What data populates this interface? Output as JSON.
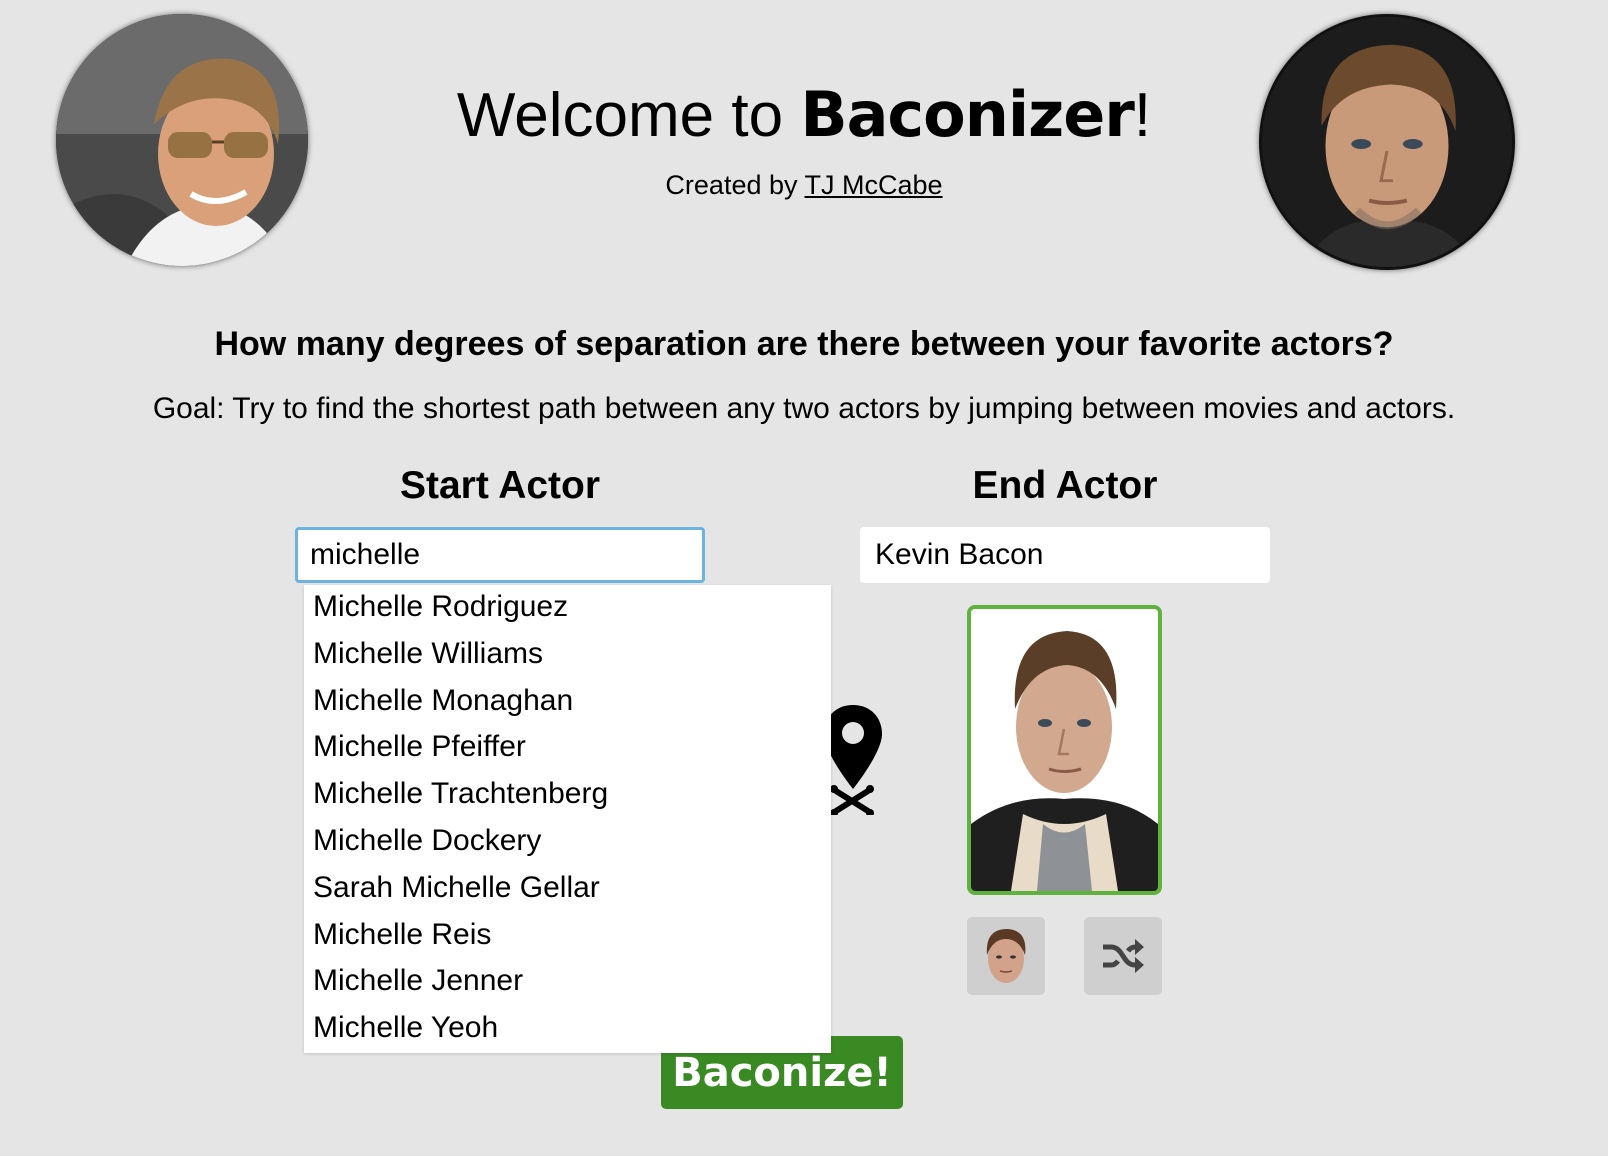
{
  "header": {
    "title_prefix": "Welcome to ",
    "title_brand": "Baconizer",
    "title_suffix": "!",
    "byline_prefix": "Created by ",
    "byline_link": "TJ McCabe"
  },
  "intro": {
    "question": "How many degrees of separation are there between your favorite actors?",
    "goal": "Goal: Try to find the shortest path between any two actors by jumping between movies and actors."
  },
  "start_actor": {
    "heading": "Start Actor",
    "input_value": "michelle",
    "suggestions": [
      "Michelle Rodriguez",
      "Michelle Williams",
      "Michelle Monaghan",
      "Michelle Pfeiffer",
      "Michelle Trachtenberg",
      "Michelle Dockery",
      "Sarah Michelle Gellar",
      "Michelle Reis",
      "Michelle Jenner",
      "Michelle Yeoh"
    ]
  },
  "end_actor": {
    "heading": "End Actor",
    "input_value": "Kevin Bacon"
  },
  "actions": {
    "baconize_label": "Baconize!"
  },
  "colors": {
    "background": "#e5e5e5",
    "input_focus_border": "#6cb3e0",
    "card_border": "#5fb33c",
    "baconize_button": "#3a8a23",
    "small_button": "#cfcfcf"
  },
  "icons": {
    "pin": "map-pin-crossed-bones-icon",
    "shuffle": "shuffle-icon",
    "face": "kevin-bacon-face-icon"
  }
}
